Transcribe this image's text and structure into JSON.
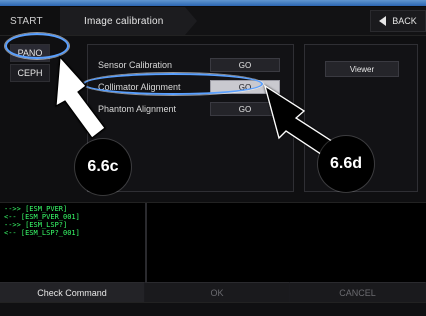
{
  "breadcrumb": {
    "start": "START",
    "current": "Image calibration"
  },
  "header": {
    "back_label": "BACK",
    "back_icon": "left-triangle-icon"
  },
  "modes": {
    "pano": "PANO",
    "ceph": "CEPH"
  },
  "calibration": {
    "rows": [
      {
        "label": "Sensor Calibration",
        "go_label": "GO"
      },
      {
        "label": "Collimator Alignment",
        "go_label": "GO"
      },
      {
        "label": "Phantom Alignment",
        "go_label": "GO"
      }
    ]
  },
  "viewer": {
    "label": "Viewer"
  },
  "callouts": {
    "c1": "6.6c",
    "c2": "6.6d"
  },
  "log": {
    "lines": [
      "-->> [ESM_PVER]",
      "<-- [ESM_PVER_001]",
      "-->> [ESM_LSP?]",
      "<-- [ESM_LSP?_001]"
    ]
  },
  "bottom": {
    "check_command": "Check Command",
    "ok": "OK",
    "cancel": "CANCEL"
  },
  "status": {
    "left": "",
    "right": ""
  },
  "colors": {
    "highlight": "#5aa0ff",
    "log_text": "#39ff6a",
    "callout_bg": "#000000",
    "active_button": "#c9c9cf"
  }
}
